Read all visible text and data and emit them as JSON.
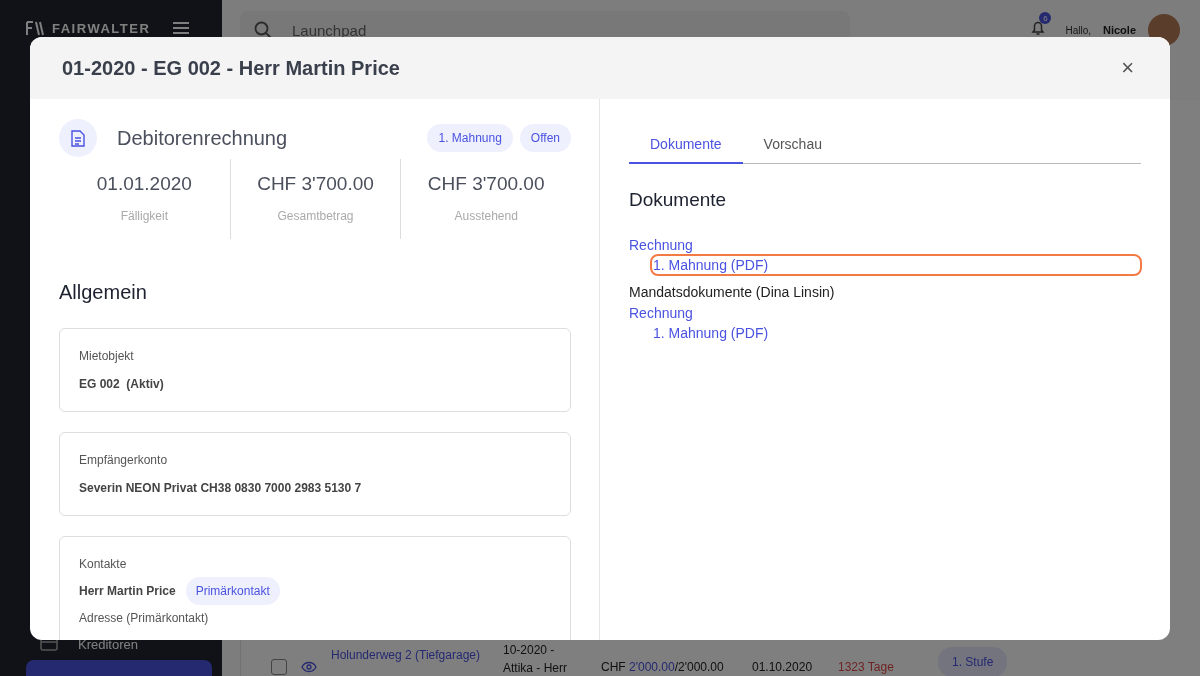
{
  "app": {
    "logo": "FAIRWALTER",
    "search": {
      "placeholder": "Launchpad"
    },
    "notifications": "6",
    "greeting": "Hallo,",
    "user": "Nicole",
    "sidebar_items": [
      {
        "label": "Kreditoren",
        "selected": false
      },
      {
        "selected": true
      }
    ],
    "table_row": {
      "checked": false,
      "property": "Holunderweg 2 (Tiefgarage)",
      "invoice": "10-2020 - Attika - Herr",
      "currency": "CHF",
      "paid": "2'000.00",
      "total": "/2'000.00",
      "date": "01.10.2020",
      "overdue": "1323 Tage",
      "level": "1. Stufe"
    }
  },
  "modal": {
    "title": "01-2020 - EG 002 - Herr Martin Price",
    "close": "×",
    "invoice": {
      "title": "Debitorenrechnung",
      "badges": [
        "1. Mahnung",
        "Offen"
      ],
      "stats": [
        {
          "value": "01.01.2020",
          "label": "Fälligkeit"
        },
        {
          "value": "CHF 3'700.00",
          "label": "Gesamtbetrag"
        },
        {
          "value": "CHF 3'700.00",
          "label": "Ausstehend"
        }
      ]
    },
    "section_title": "Allgemein",
    "cards": [
      {
        "kind": "field",
        "label": "Mietobjekt",
        "value": "EG 002  (Aktiv)"
      },
      {
        "kind": "field",
        "label": "Empfängerkonto",
        "value": "Severin NEON Privat CH38 0830 7000 2983 5130 7"
      },
      {
        "kind": "contact",
        "label": "Kontakte",
        "name": "Herr Martin Price",
        "tag": "Primärkontakt",
        "sublabel": "Adresse (Primärkontakt)"
      }
    ],
    "tabs": [
      {
        "label": "Dokumente",
        "selected": true
      },
      {
        "label": "Vorschau",
        "selected": false
      }
    ],
    "documents_title": "Dokumente",
    "documents": [
      {
        "kind": "link",
        "label": "Rechnung",
        "children": [
          {
            "kind": "link",
            "label": "1. Mahnung (PDF)",
            "highlighted": true
          }
        ]
      },
      {
        "kind": "heading",
        "label": "Mandatsdokumente (Dina Linsin)"
      },
      {
        "kind": "link",
        "label": "Rechnung",
        "children": [
          {
            "kind": "link",
            "label": "1. Mahnung (PDF)",
            "highlighted": false
          }
        ]
      }
    ]
  }
}
